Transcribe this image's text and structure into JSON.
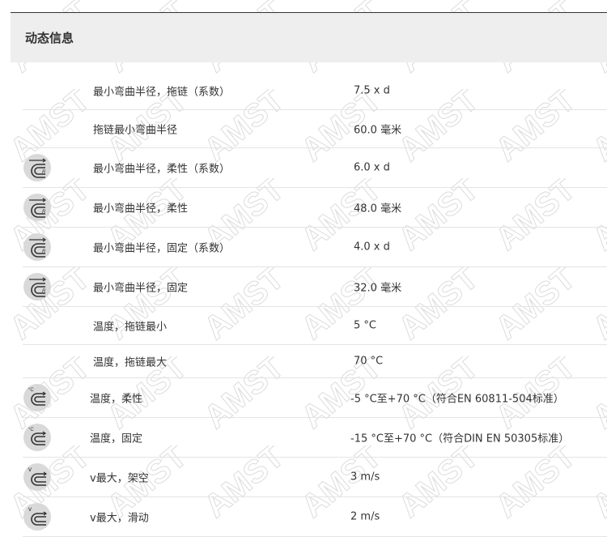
{
  "section": {
    "title": "动态信息"
  },
  "rows": [
    {
      "label": "最小弯曲半径，拖链（系数）",
      "value": "7.5 x d",
      "icon": ""
    },
    {
      "label": "拖链最小弯曲半径",
      "value": "60.0 毫米",
      "icon": ""
    },
    {
      "label": "最小弯曲半径，柔性（系数）",
      "value": "6.0 x d",
      "icon": "bend-radius-icon"
    },
    {
      "label": "最小弯曲半径，柔性",
      "value": "48.0 毫米",
      "icon": "bend-radius-icon"
    },
    {
      "label": "最小弯曲半径，固定（系数）",
      "value": "4.0 x d",
      "icon": "bend-radius-icon"
    },
    {
      "label": "最小弯曲半径，固定",
      "value": "32.0 毫米",
      "icon": "bend-radius-icon"
    },
    {
      "label": "温度，拖链最小",
      "value": "5 °C",
      "icon": ""
    },
    {
      "label": "温度，拖链最大",
      "value": "70 °C",
      "icon": ""
    },
    {
      "label": "温度，柔性",
      "value": "-5 °C至+70 °C（符合EN 60811-504标准）",
      "icon": "temperature-icon"
    },
    {
      "label": "温度，固定",
      "value": "-15 °C至+70 °C（符合DIN EN 50305标准）",
      "icon": "temperature-icon"
    },
    {
      "label": "v最大，架空",
      "value": "3 m/s",
      "icon": "velocity-icon"
    },
    {
      "label": "v最大，滑动",
      "value": "2 m/s",
      "icon": "velocity-icon"
    }
  ],
  "icon_glyphs": {
    "bend_label": "R",
    "temp_label": "°C",
    "vel_label": "v"
  },
  "watermark": {
    "text": "AMST"
  }
}
